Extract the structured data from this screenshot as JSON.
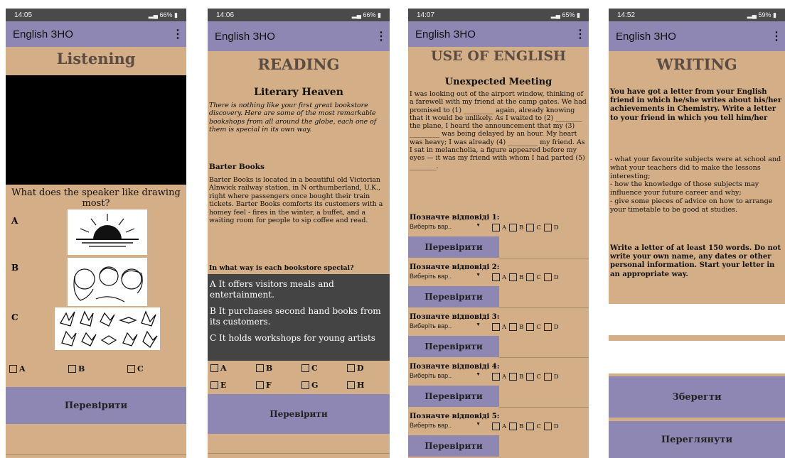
{
  "app_title": "English ЗНО",
  "screens": {
    "listening": {
      "time": "14:05",
      "battery": "66%",
      "title": "Listening",
      "question": "What does the speaker like drawing most?",
      "options": [
        "A",
        "B",
        "C"
      ],
      "check_button": "Перевірити"
    },
    "reading": {
      "time": "14:06",
      "battery": "66%",
      "title": "READING",
      "subtitle": "Literary Heaven",
      "intro": "There is nothing like your first great bookstore discovery. Here are some of the most remarkable bookshops from all around the globe, each one of them is special in its own way.",
      "section_title": "Barter Books",
      "section_text": "Barter Books is located in a beautiful old Victorian Alnwick railway station, in N orthumberland, U.K., right where passengers once bought their train tickets. Barter Books comforts its customers with a homey feel - fires in the winter, a buffet, and a waiting room for people to sip coffee and read.",
      "question": "In what way is each bookstore special?",
      "answers": [
        "A It offers visitors meals and entertainment.",
        "B It purchases second hand books from its customers.",
        "C It holds workshops for young artists"
      ],
      "options_row1": [
        "A",
        "B",
        "C",
        "D"
      ],
      "options_row2": [
        "E",
        "F",
        "G",
        "H"
      ],
      "check_button": "Перевірити"
    },
    "use_of_english": {
      "time": "14:07",
      "battery": "65%",
      "title": "USE OF ENGLISH",
      "subtitle": "Unexpected Meeting",
      "text": "I was looking out of the airport window, thinking of a farewell with my friend at the camp gates. We had promised to (1) _________ again, already knowing that it would be unlikely. As I waited to (2) ________ the plane, I heard the announcement that my (3) _________ was being delayed by an hour. My heart was heavy; I was already (4) _________ my friend. As I sat in melancholia, a figure appeared before my eyes — it was my friend with whom I had parted (5) ________.",
      "answer_labels": [
        "Позначте відповіді 1:",
        "Позначте відповіді 2:",
        "Позначте відповіді 3:",
        "Позначте відповіді 4:",
        "Позначте відповіді 5:"
      ],
      "select_placeholder": "Виберіть вар..",
      "options": [
        "A",
        "B",
        "C",
        "D"
      ],
      "check_button": "Перевірити"
    },
    "writing": {
      "time": "14:52",
      "battery": "59%",
      "title": "WRITING",
      "task": "You have got a letter from your English friend in which he/she writes about his/her achievements in Chemistry. Write a letter to your friend in which you tell him/her",
      "points": "- what your favourite subjects were at school and what your teachers did to make the lessons interesting;\n- how the knowledge of those subjects may influence your future career and why;\n- give some pieces of advice on how to arrange your timetable to be good at studies.",
      "note": "Write a letter of at least 150 words. Do not write your own name, any dates or other personal information. Start your letter in an appropriate way.",
      "save_button": "Зберегти",
      "view_button": "Переглянути"
    }
  }
}
